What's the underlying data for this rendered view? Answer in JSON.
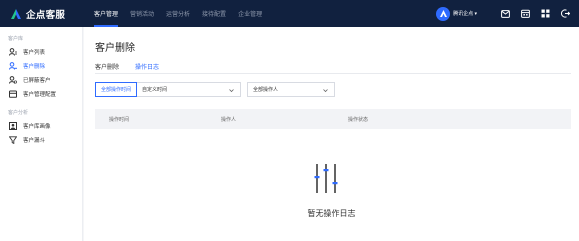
{
  "brand": {
    "name": "企点客服"
  },
  "topnav": [
    {
      "label": "客户管理",
      "active": true
    },
    {
      "label": "营销活动",
      "active": false
    },
    {
      "label": "运营分析",
      "active": false
    },
    {
      "label": "接待配置",
      "active": false
    },
    {
      "label": "企业管理",
      "active": false
    }
  ],
  "user": {
    "name": "腾讯企点 ▾"
  },
  "sidebar": {
    "group1": "客户库",
    "group2": "客户分析",
    "items": [
      {
        "label": "客户列表",
        "icon": "customer-list-icon",
        "active": false
      },
      {
        "label": "客户删除",
        "icon": "customer-delete-icon",
        "active": true
      },
      {
        "label": "已屏蔽客户",
        "icon": "blocked-customer-icon",
        "active": false
      },
      {
        "label": "客户管理配置",
        "icon": "customer-config-icon",
        "active": false
      },
      {
        "label": "客户库画像",
        "icon": "portrait-icon",
        "active": false
      },
      {
        "label": "客户漏斗",
        "icon": "funnel-icon",
        "active": false
      }
    ]
  },
  "page": {
    "title": "客户删除",
    "tabs": [
      {
        "label": "客户删除",
        "active": false
      },
      {
        "label": "操作日志",
        "active": true
      }
    ],
    "filters": {
      "time_button": "全部操作时间",
      "time_select": "自定义时间",
      "operator_select": "全部操作人"
    },
    "table": {
      "columns": [
        "操作时间",
        "操作人",
        "操作状态"
      ]
    },
    "empty_text": "暂无操作日志"
  },
  "colors": {
    "accent": "#2f6bff",
    "topbar": "#11213f"
  }
}
